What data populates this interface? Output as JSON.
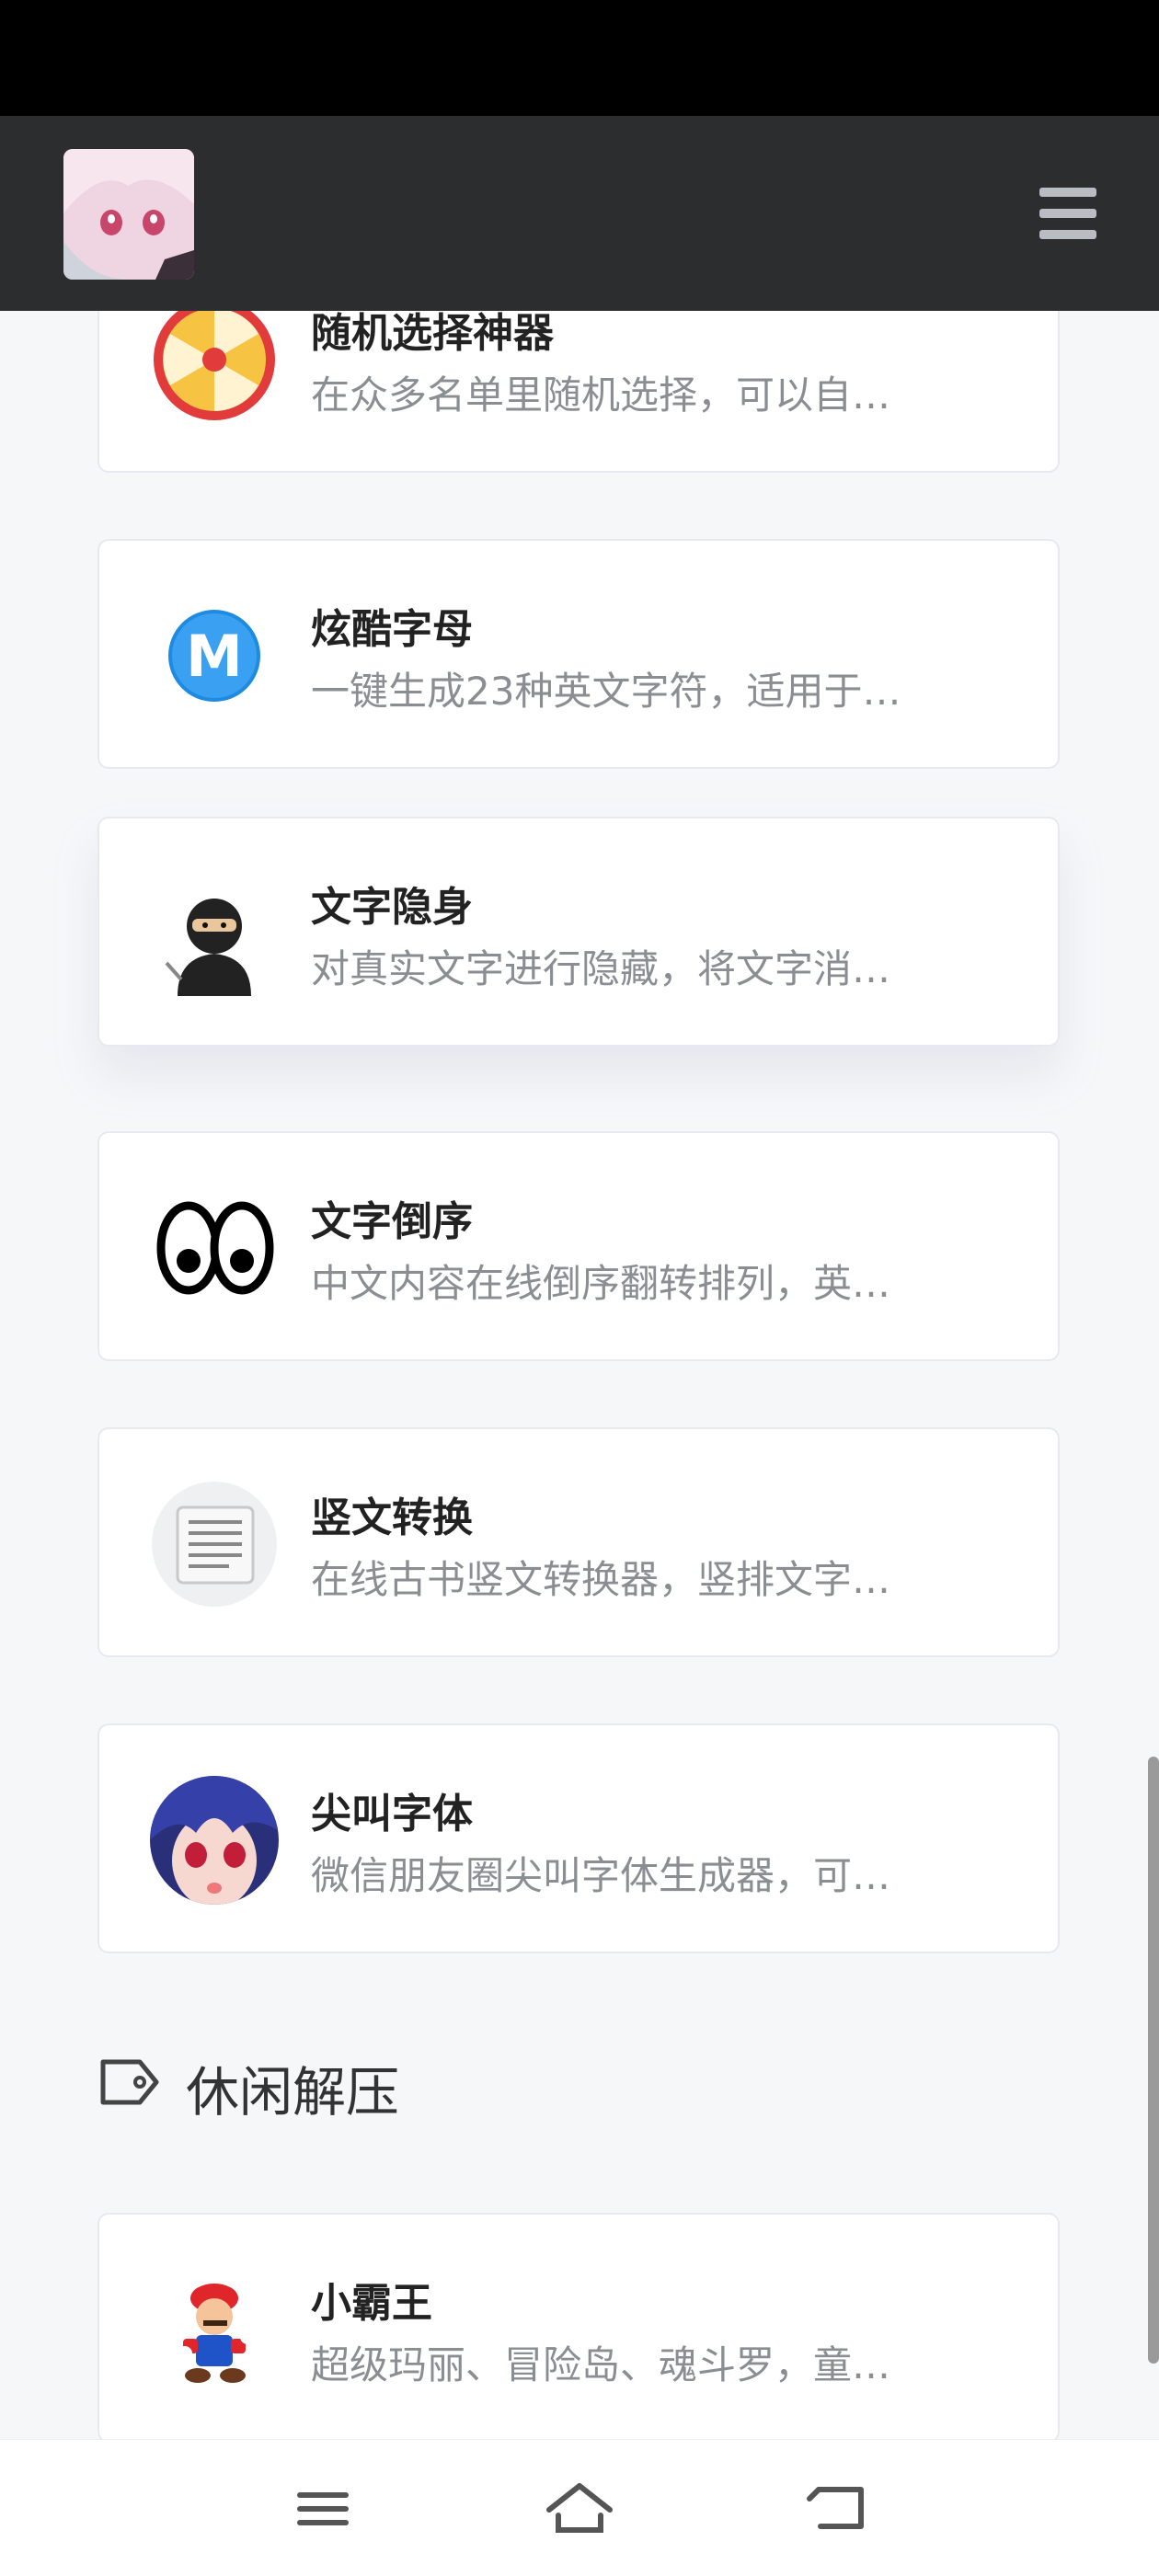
{
  "header": {
    "avatar": "avatar-image",
    "menu_icon": "hamburger-menu-icon"
  },
  "cards_top": [
    {
      "title": "随机选择神器",
      "desc": "在众多名单里随机选择，可以自…",
      "icon": "spin-wheel-icon"
    },
    {
      "title": "炫酷字母",
      "desc": "一键生成23种英文字符，适用于…",
      "icon": "letter-m-icon"
    },
    {
      "title": "文字隐身",
      "desc": "对真实文字进行隐藏，将文字消…",
      "icon": "ninja-icon"
    },
    {
      "title": "文字倒序",
      "desc": "中文内容在线倒序翻转排列，英…",
      "icon": "eyes-icon"
    },
    {
      "title": "竖文转换",
      "desc": "在线古书竖文转换器，竖排文字…",
      "icon": "scroll-document-icon"
    },
    {
      "title": "尖叫字体",
      "desc": "微信朋友圈尖叫字体生成器，可…",
      "icon": "anime-face-icon"
    }
  ],
  "section": {
    "label": "休闲解压",
    "icon": "tag-icon"
  },
  "cards_bottom": [
    {
      "title": "小霸王",
      "desc": "超级玛丽、冒险岛、魂斗罗，童…",
      "icon": "mario-icon"
    }
  ],
  "nav": {
    "menu": "nav-menu-icon",
    "home": "home-icon",
    "back": "back-icon"
  }
}
